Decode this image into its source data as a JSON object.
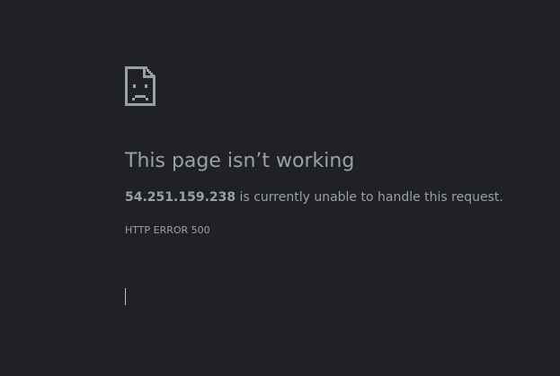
{
  "page": {
    "icon": "sad-file-icon",
    "title": "This page isn’t working",
    "host": "54.251.159.238",
    "summary_rest": " is currently unable to handle this request.",
    "error_code": "HTTP ERROR 500"
  },
  "colors": {
    "background": "#202124",
    "text": "#9aa0a6"
  }
}
